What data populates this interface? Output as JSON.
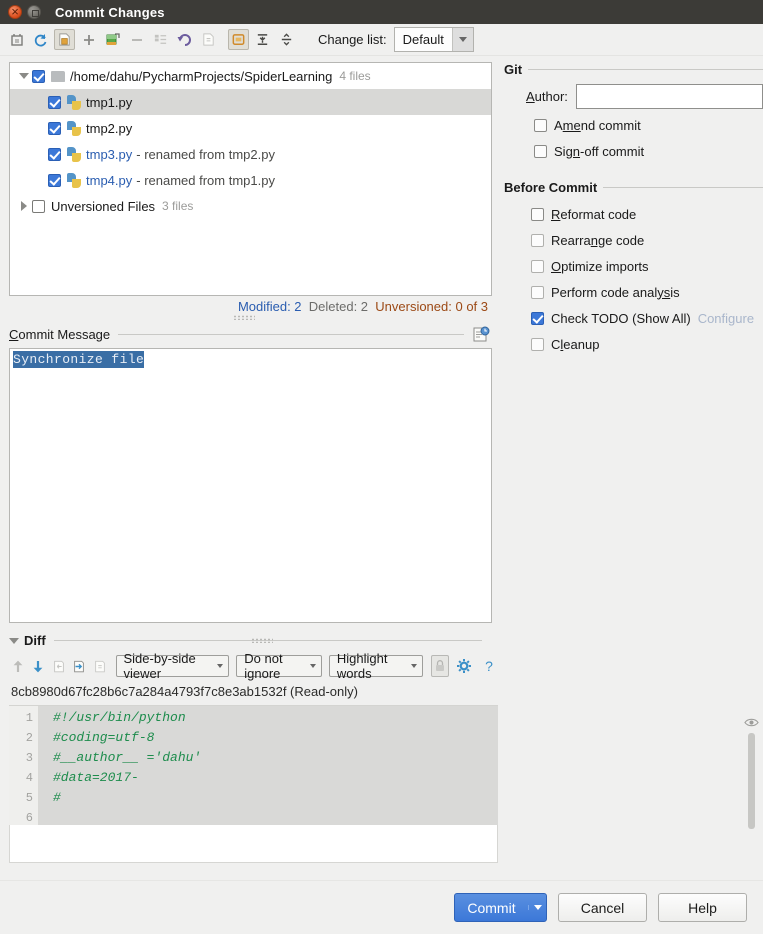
{
  "window": {
    "title": "Commit Changes",
    "close_icon": "close-icon",
    "maximize_icon": "maximize-icon"
  },
  "toolbar": {
    "icons": [
      "refresh-changes-icon",
      "rollback-sync-icon",
      "show-diff-icon",
      "add-icon",
      "move-to-changelist-icon",
      "remove-icon",
      "group-by-icon",
      "revert-icon",
      "show-diff-preview-icon",
      "expand-icon",
      "collapse-all-icon",
      "split-icon"
    ],
    "changelist_label": "Change list:",
    "changelist_value": "Default"
  },
  "tree": {
    "root": {
      "path": "/home/dahu/PycharmProjects/SpiderLearning",
      "count": "4 files",
      "checked": true,
      "expanded": true
    },
    "files": [
      {
        "name": "tmp1.py",
        "note": "",
        "checked": true,
        "selected": true,
        "kind": "modified"
      },
      {
        "name": "tmp2.py",
        "note": "",
        "checked": true,
        "selected": false,
        "kind": "modified"
      },
      {
        "name": "tmp3.py",
        "note": "- renamed from tmp2.py",
        "checked": true,
        "selected": false,
        "kind": "renamed"
      },
      {
        "name": "tmp4.py",
        "note": "- renamed from tmp1.py",
        "checked": true,
        "selected": false,
        "kind": "renamed"
      }
    ],
    "unversioned": {
      "label": "Unversioned Files",
      "count": "3 files",
      "checked": false,
      "expanded": false
    },
    "status": {
      "modified": "Modified: 2",
      "deleted": "Deleted: 2",
      "unversioned": "Unversioned: 0 of 3"
    }
  },
  "commit_message": {
    "title": "Commit Message",
    "value": "Synchronize file",
    "history_icon": "message-history-icon"
  },
  "diff": {
    "section_label": "Diff",
    "expanded": true,
    "toolbar": {
      "prev_difference_icon": "arrow-up-icon",
      "next_difference_icon": "arrow-down-icon",
      "accept_left_icon": "apply-left-icon",
      "accept_right_icon": "apply-right-icon",
      "copy_icon": "copy-file-icon",
      "viewer": "Side-by-side viewer",
      "whitespace": "Do not ignore",
      "highlight": "Highlight words",
      "lock_icon": "lock-icon",
      "settings_icon": "gear-icon",
      "help_icon": "question-mark-icon"
    },
    "revision": "8cb8980d67fc28b6c7a284a4793f7c8e3ab1532f (Read-only)",
    "gutter_eye_icon": "eye-icon",
    "lines": [
      {
        "no": "1",
        "text": "#!/usr/bin/python"
      },
      {
        "no": "2",
        "text": "#coding=utf-8"
      },
      {
        "no": "3",
        "text": "#__author__ ='dahu'"
      },
      {
        "no": "4",
        "text": "#data=2017-"
      },
      {
        "no": "5",
        "text": "#"
      },
      {
        "no": "6",
        "text": ""
      }
    ]
  },
  "git_panel": {
    "title": "Git",
    "author_label": "Author:",
    "author_value": "",
    "author_placeholder": "",
    "options": [
      {
        "label": "Amend commit",
        "checked": false,
        "mnemonic": "me"
      },
      {
        "label": "Sign-off commit",
        "checked": false,
        "mnemonic": "gn"
      }
    ]
  },
  "before_commit": {
    "title": "Before Commit",
    "options": [
      {
        "label": "Reformat code",
        "checked": false,
        "enabled": true
      },
      {
        "label": "Rearrange code",
        "checked": false,
        "enabled": false
      },
      {
        "label": "Optimize imports",
        "checked": false,
        "enabled": false
      },
      {
        "label": "Perform code analysis",
        "checked": false,
        "enabled": false
      },
      {
        "label": "Check TODO (Show All)",
        "checked": true,
        "enabled": true,
        "link": "Configure"
      },
      {
        "label": "Cleanup",
        "checked": false,
        "enabled": false
      }
    ]
  },
  "footer": {
    "commit": "Commit",
    "cancel": "Cancel",
    "help": "Help"
  },
  "colors": {
    "accent": "#3c78d8",
    "renamed_file": "#2a5db0",
    "unversioned": "#9c4a16",
    "comment_green": "#1d8c4c",
    "titlebar": "#3c3b37"
  }
}
